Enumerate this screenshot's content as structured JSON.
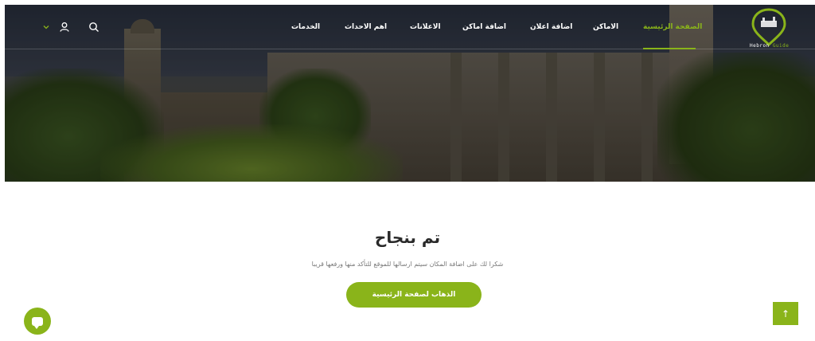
{
  "colors": {
    "accent": "#8ab41a",
    "title": "#2a2a2a",
    "muted": "#7a7a7a"
  },
  "logo": {
    "text_part1": "Hebron",
    "text_part2": "Guide"
  },
  "nav": {
    "items": [
      {
        "label": "الصفحة الرئيسية",
        "active": true
      },
      {
        "label": "الاماكن"
      },
      {
        "label": "اضافة اعلان"
      },
      {
        "label": "اضافة اماكن"
      },
      {
        "label": "الاعلانات"
      },
      {
        "label": "اهم الاحداث"
      },
      {
        "label": "الخدمات"
      }
    ],
    "icons": [
      "search-icon",
      "user-icon",
      "chevron-down-icon"
    ]
  },
  "main": {
    "title": "تم بنجاح",
    "message": "شكرا لك على اضافة المكان سيتم ارسالها للموقع للتأكد منها ورفعها قريبا",
    "home_button": "الذهاب لصفحة الرئيسية"
  },
  "floating": {
    "chat_icon": "chat-icon",
    "scroll_top_icon": "arrow-up-icon",
    "scroll_top_glyph": "↑"
  }
}
